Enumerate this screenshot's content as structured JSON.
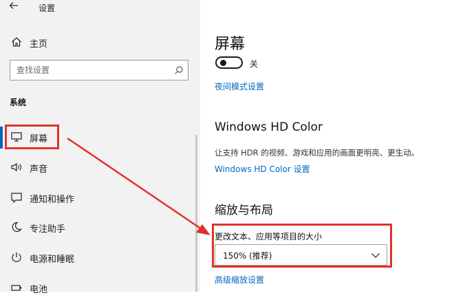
{
  "window": {
    "title": "设置"
  },
  "sidebar": {
    "home_label": "主页",
    "search": {
      "placeholder": "查找设置",
      "value": ""
    },
    "section_title": "系统",
    "items": [
      {
        "label": "屏幕",
        "icon": "monitor-icon",
        "selected": true
      },
      {
        "label": "声音",
        "icon": "speaker-icon"
      },
      {
        "label": "通知和操作",
        "icon": "notification-icon"
      },
      {
        "label": "专注助手",
        "icon": "moon-icon"
      },
      {
        "label": "电源和睡眠",
        "icon": "power-icon"
      },
      {
        "label": "电池",
        "icon": "battery-icon"
      }
    ]
  },
  "main": {
    "title": "屏幕",
    "night_light": {
      "state_label": "关",
      "on": false
    },
    "night_light_link": "夜间模式设置",
    "hd_color": {
      "title": "Windows HD Color",
      "description": "让支持 HDR 的视频、游戏和应用的画面更明亮、更生动。",
      "link": "Windows HD Color 设置"
    },
    "scale_layout": {
      "title": "缩放与布局",
      "label": "更改文本、应用等项目的大小",
      "selected": "150% (推荐)",
      "link": "高级缩放设置"
    }
  },
  "colors": {
    "accent": "#0067c0",
    "annotation": "#e0322c",
    "sidebar_bg": "#f2f2f2"
  }
}
